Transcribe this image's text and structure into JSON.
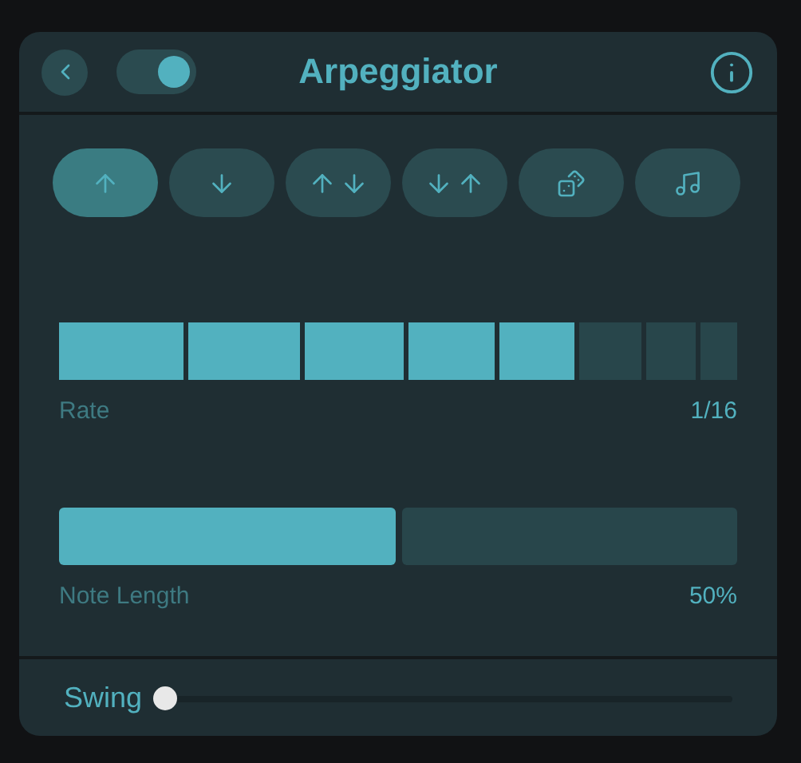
{
  "header": {
    "title": "Arpeggiator",
    "enabled": true
  },
  "modes": [
    {
      "kind": "up",
      "selected": true
    },
    {
      "kind": "down",
      "selected": false
    },
    {
      "kind": "up-down",
      "selected": false
    },
    {
      "kind": "down-up",
      "selected": false
    },
    {
      "kind": "random",
      "selected": false
    },
    {
      "kind": "chord",
      "selected": false
    }
  ],
  "rate": {
    "label": "Rate",
    "value": "1/16",
    "steps": [
      {
        "on": true
      },
      {
        "on": true
      },
      {
        "on": true
      },
      {
        "on": true
      },
      {
        "on": true
      },
      {
        "on": false
      },
      {
        "on": false
      },
      {
        "on": false
      }
    ]
  },
  "note_length": {
    "label": "Note Length",
    "value": "50%",
    "level": 0.5
  },
  "swing": {
    "label": "Swing",
    "level": 0
  }
}
